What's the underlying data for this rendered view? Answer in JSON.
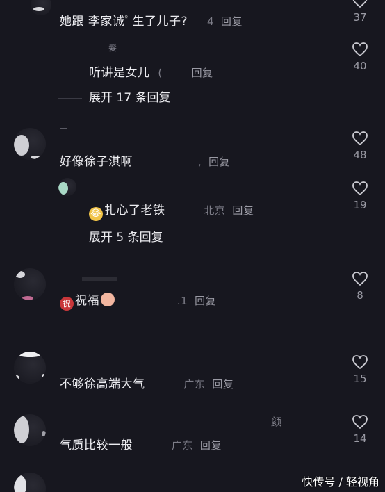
{
  "comments": [
    {
      "text": "她跟 李家诚",
      "text_suffix": "生了儿子?",
      "meta": "4",
      "reply": "回复",
      "likes": "37"
    },
    {
      "name": "髮",
      "text": "听讲是女儿",
      "meta": "(",
      "reply": "回复",
      "likes": "40"
    },
    {
      "expand": "展开 17 条回复"
    },
    {
      "text": "好像徐子淇啊",
      "meta": ",",
      "reply": "回复",
      "likes": "48"
    },
    {
      "text": "扎心了老铁",
      "meta": "北京",
      "reply": "回复",
      "likes": "19",
      "emoji": "😂"
    },
    {
      "expand": "展开 5 条回复"
    },
    {
      "text": "祝福",
      "badge": "祝",
      "meta": ".1",
      "reply": "回复",
      "likes": "8"
    },
    {
      "text": "不够徐高端大气",
      "meta": "广东",
      "reply": "回复",
      "likes": "15"
    },
    {
      "name": "颜",
      "text": "气质比较一般",
      "meta": "广东",
      "reply": "回复",
      "likes": "14"
    }
  ],
  "watermark": "快传号 / 轻视角",
  "colors": {
    "background": "#17171f",
    "text": "#ececf0",
    "muted": "#7d7d88",
    "badge_red": "#c8373a",
    "emoji_peach": "#f2b6a0"
  },
  "icons": [
    "heart-outline-icon"
  ]
}
